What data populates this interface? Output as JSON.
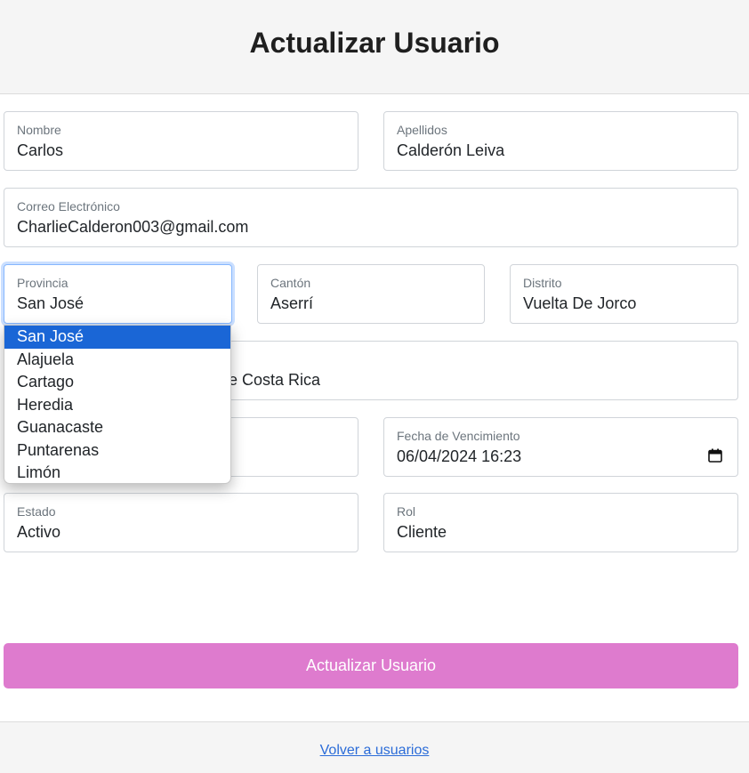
{
  "header": {
    "title": "Actualizar Usuario"
  },
  "form": {
    "nombre": {
      "label": "Nombre",
      "value": "Carlos"
    },
    "apellidos": {
      "label": "Apellidos",
      "value": "Calderón Leiva"
    },
    "correo": {
      "label": "Correo Electrónico",
      "value": "CharlieCalderon003@gmail.com"
    },
    "provincia": {
      "label": "Provincia",
      "value": "San José"
    },
    "canton": {
      "label": "Cantón",
      "value": "Aserrí"
    },
    "distrito": {
      "label": "Distrito",
      "value": "Vuelta De Jorco"
    },
    "direccion": {
      "value_visible_part": "e Costa Rica"
    },
    "fecha_vencimiento": {
      "label": "Fecha de Vencimiento",
      "value": "06/04/2024 16:23"
    },
    "estado": {
      "label": "Estado",
      "value": "Activo"
    },
    "rol": {
      "label": "Rol",
      "value": "Cliente"
    }
  },
  "provincia_dropdown": {
    "options": [
      "San José",
      "Alajuela",
      "Cartago",
      "Heredia",
      "Guanacaste",
      "Puntarenas",
      "Limón"
    ],
    "selected": "San José"
  },
  "submit_label": "Actualizar Usuario",
  "footer": {
    "link_label": "Volver a usuarios"
  },
  "colors": {
    "submit_button": "#de7bce",
    "selected_option": "#1a66d6",
    "link": "#2b6cd8",
    "focus_border": "#86b7fe"
  }
}
